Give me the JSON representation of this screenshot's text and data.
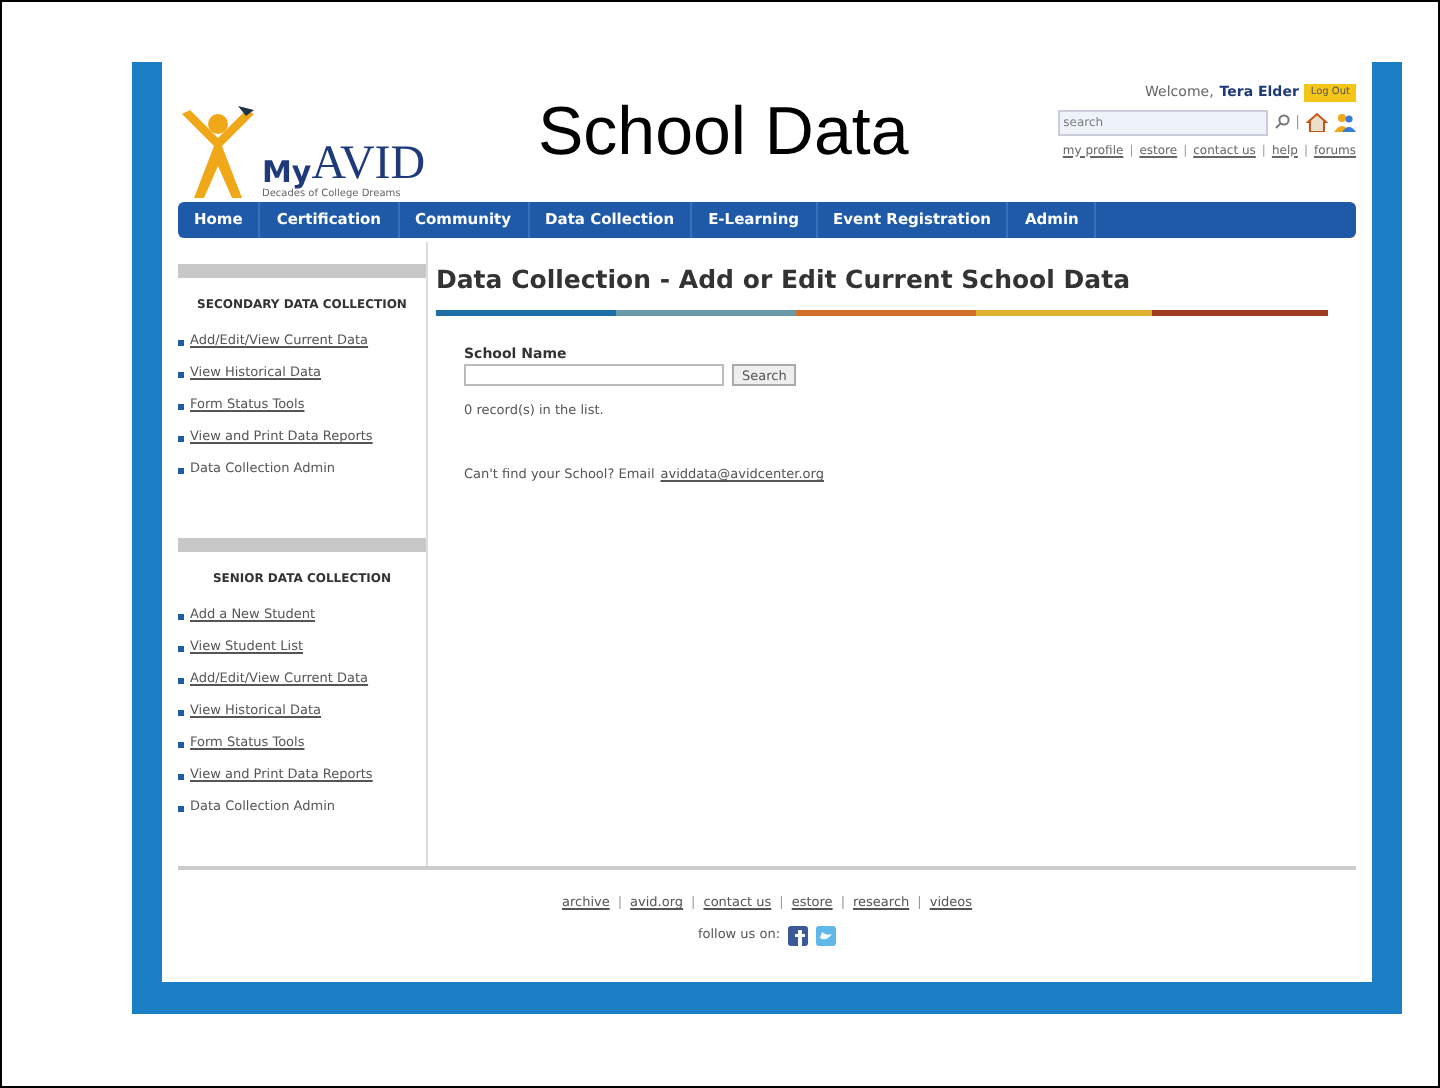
{
  "slide_title": "School Data",
  "logo": {
    "my": "My",
    "avid": "AVID",
    "tagline": "Decades of College Dreams"
  },
  "header": {
    "welcome": "Welcome,",
    "user": "Tera Elder",
    "logout": "Log Out",
    "search_placeholder": "search",
    "sep": "|",
    "links": [
      "my profile",
      "estore",
      "contact us",
      "help",
      "forums"
    ]
  },
  "nav": [
    {
      "label": "Home"
    },
    {
      "label": "Certification"
    },
    {
      "label": "Community"
    },
    {
      "label": "Data Collection"
    },
    {
      "label": "E-Learning"
    },
    {
      "label": "Event Registration"
    },
    {
      "label": "Admin"
    }
  ],
  "sidebar": [
    {
      "title": "SECONDARY DATA COLLECTION",
      "items": [
        {
          "label": "Add/Edit/View Current Data",
          "link": true
        },
        {
          "label": "View Historical Data",
          "link": true
        },
        {
          "label": "Form Status Tools",
          "link": true
        },
        {
          "label": "View and Print Data Reports",
          "link": true
        },
        {
          "label": "Data Collection Admin",
          "link": false
        }
      ]
    },
    {
      "title": "SENIOR DATA COLLECTION",
      "items": [
        {
          "label": "Add a New Student",
          "link": true
        },
        {
          "label": "View Student List",
          "link": true
        },
        {
          "label": "Add/Edit/View Current Data",
          "link": true
        },
        {
          "label": "View Historical Data",
          "link": true
        },
        {
          "label": "Form Status Tools",
          "link": true
        },
        {
          "label": "View and Print Data Reports",
          "link": true
        },
        {
          "label": "Data Collection Admin",
          "link": false
        }
      ]
    }
  ],
  "main": {
    "heading": "Data Collection - Add or Edit Current School Data",
    "field_label": "School Name",
    "search_button": "Search",
    "records": "0 record(s) in the list.",
    "help_text": "Can't find your School? Email",
    "email": "aviddata@avidcenter.org"
  },
  "footer": {
    "links": [
      "archive",
      "avid.org",
      "contact us",
      "estore",
      "research",
      "videos"
    ],
    "sep": "|",
    "follow": "follow us on:"
  }
}
